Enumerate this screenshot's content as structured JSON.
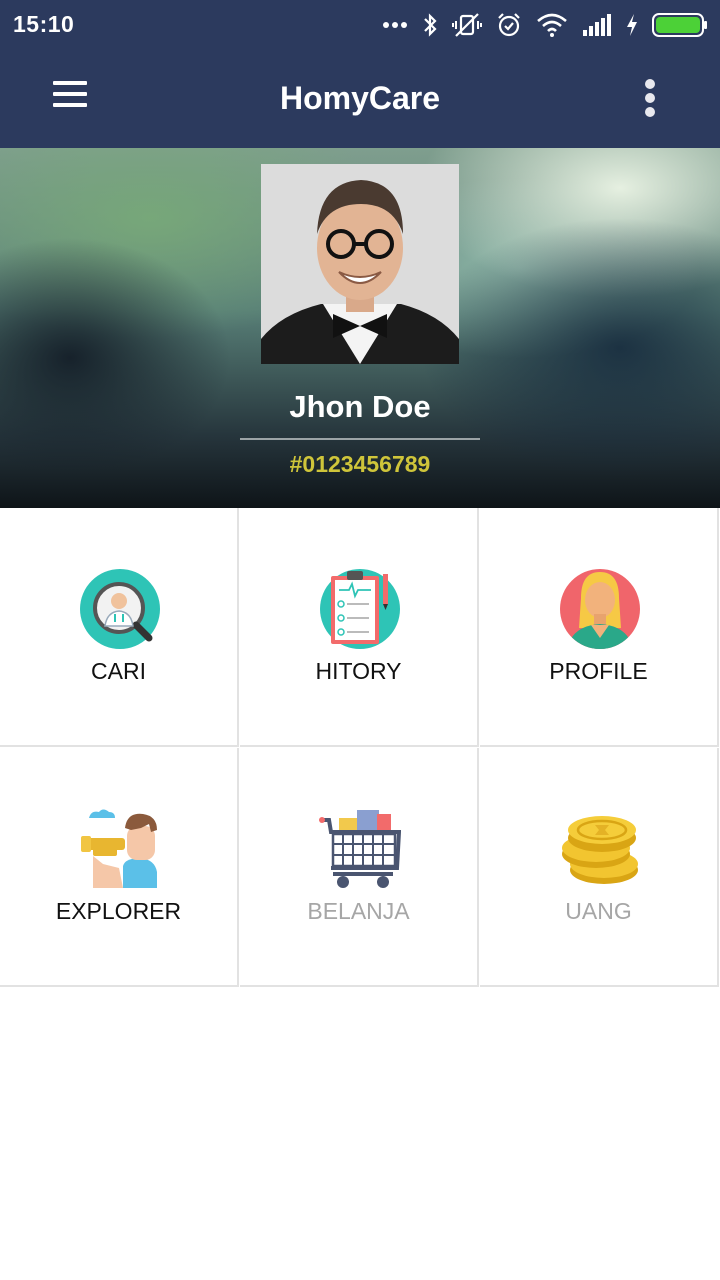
{
  "status_bar": {
    "time": "15:10"
  },
  "app_bar": {
    "title": "HomyCare"
  },
  "profile": {
    "name": "Jhon Doe",
    "id": "#0123456789"
  },
  "menu": [
    {
      "label": "CARI"
    },
    {
      "label": "HITORY"
    },
    {
      "label": "PROFILE"
    },
    {
      "label": "EXPLORER"
    },
    {
      "label": "BELANJA"
    },
    {
      "label": "UANG"
    }
  ],
  "colors": {
    "primary": "#2c3a5e",
    "id_text": "#cfc53a",
    "teal": "#2ec4b6",
    "battery": "#4cd137"
  }
}
